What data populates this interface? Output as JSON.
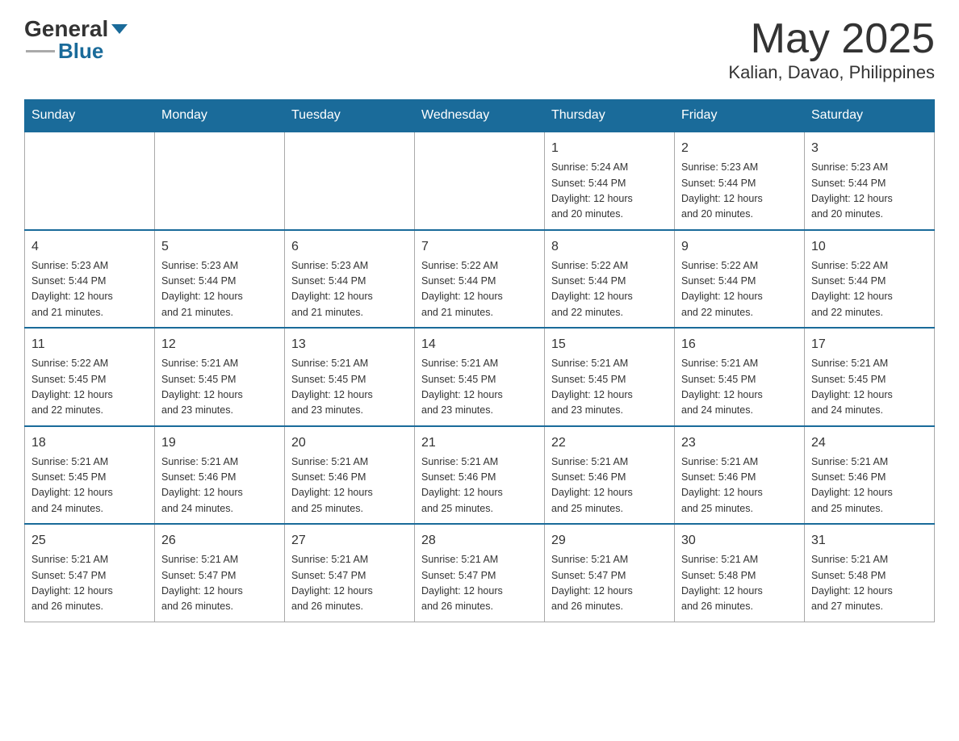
{
  "header": {
    "logo_general": "General",
    "logo_blue": "Blue",
    "month_year": "May 2025",
    "location": "Kalian, Davao, Philippines"
  },
  "days_of_week": [
    "Sunday",
    "Monday",
    "Tuesday",
    "Wednesday",
    "Thursday",
    "Friday",
    "Saturday"
  ],
  "weeks": [
    [
      {
        "day": "",
        "info": ""
      },
      {
        "day": "",
        "info": ""
      },
      {
        "day": "",
        "info": ""
      },
      {
        "day": "",
        "info": ""
      },
      {
        "day": "1",
        "info": "Sunrise: 5:24 AM\nSunset: 5:44 PM\nDaylight: 12 hours\nand 20 minutes."
      },
      {
        "day": "2",
        "info": "Sunrise: 5:23 AM\nSunset: 5:44 PM\nDaylight: 12 hours\nand 20 minutes."
      },
      {
        "day": "3",
        "info": "Sunrise: 5:23 AM\nSunset: 5:44 PM\nDaylight: 12 hours\nand 20 minutes."
      }
    ],
    [
      {
        "day": "4",
        "info": "Sunrise: 5:23 AM\nSunset: 5:44 PM\nDaylight: 12 hours\nand 21 minutes."
      },
      {
        "day": "5",
        "info": "Sunrise: 5:23 AM\nSunset: 5:44 PM\nDaylight: 12 hours\nand 21 minutes."
      },
      {
        "day": "6",
        "info": "Sunrise: 5:23 AM\nSunset: 5:44 PM\nDaylight: 12 hours\nand 21 minutes."
      },
      {
        "day": "7",
        "info": "Sunrise: 5:22 AM\nSunset: 5:44 PM\nDaylight: 12 hours\nand 21 minutes."
      },
      {
        "day": "8",
        "info": "Sunrise: 5:22 AM\nSunset: 5:44 PM\nDaylight: 12 hours\nand 22 minutes."
      },
      {
        "day": "9",
        "info": "Sunrise: 5:22 AM\nSunset: 5:44 PM\nDaylight: 12 hours\nand 22 minutes."
      },
      {
        "day": "10",
        "info": "Sunrise: 5:22 AM\nSunset: 5:44 PM\nDaylight: 12 hours\nand 22 minutes."
      }
    ],
    [
      {
        "day": "11",
        "info": "Sunrise: 5:22 AM\nSunset: 5:45 PM\nDaylight: 12 hours\nand 22 minutes."
      },
      {
        "day": "12",
        "info": "Sunrise: 5:21 AM\nSunset: 5:45 PM\nDaylight: 12 hours\nand 23 minutes."
      },
      {
        "day": "13",
        "info": "Sunrise: 5:21 AM\nSunset: 5:45 PM\nDaylight: 12 hours\nand 23 minutes."
      },
      {
        "day": "14",
        "info": "Sunrise: 5:21 AM\nSunset: 5:45 PM\nDaylight: 12 hours\nand 23 minutes."
      },
      {
        "day": "15",
        "info": "Sunrise: 5:21 AM\nSunset: 5:45 PM\nDaylight: 12 hours\nand 23 minutes."
      },
      {
        "day": "16",
        "info": "Sunrise: 5:21 AM\nSunset: 5:45 PM\nDaylight: 12 hours\nand 24 minutes."
      },
      {
        "day": "17",
        "info": "Sunrise: 5:21 AM\nSunset: 5:45 PM\nDaylight: 12 hours\nand 24 minutes."
      }
    ],
    [
      {
        "day": "18",
        "info": "Sunrise: 5:21 AM\nSunset: 5:45 PM\nDaylight: 12 hours\nand 24 minutes."
      },
      {
        "day": "19",
        "info": "Sunrise: 5:21 AM\nSunset: 5:46 PM\nDaylight: 12 hours\nand 24 minutes."
      },
      {
        "day": "20",
        "info": "Sunrise: 5:21 AM\nSunset: 5:46 PM\nDaylight: 12 hours\nand 25 minutes."
      },
      {
        "day": "21",
        "info": "Sunrise: 5:21 AM\nSunset: 5:46 PM\nDaylight: 12 hours\nand 25 minutes."
      },
      {
        "day": "22",
        "info": "Sunrise: 5:21 AM\nSunset: 5:46 PM\nDaylight: 12 hours\nand 25 minutes."
      },
      {
        "day": "23",
        "info": "Sunrise: 5:21 AM\nSunset: 5:46 PM\nDaylight: 12 hours\nand 25 minutes."
      },
      {
        "day": "24",
        "info": "Sunrise: 5:21 AM\nSunset: 5:46 PM\nDaylight: 12 hours\nand 25 minutes."
      }
    ],
    [
      {
        "day": "25",
        "info": "Sunrise: 5:21 AM\nSunset: 5:47 PM\nDaylight: 12 hours\nand 26 minutes."
      },
      {
        "day": "26",
        "info": "Sunrise: 5:21 AM\nSunset: 5:47 PM\nDaylight: 12 hours\nand 26 minutes."
      },
      {
        "day": "27",
        "info": "Sunrise: 5:21 AM\nSunset: 5:47 PM\nDaylight: 12 hours\nand 26 minutes."
      },
      {
        "day": "28",
        "info": "Sunrise: 5:21 AM\nSunset: 5:47 PM\nDaylight: 12 hours\nand 26 minutes."
      },
      {
        "day": "29",
        "info": "Sunrise: 5:21 AM\nSunset: 5:47 PM\nDaylight: 12 hours\nand 26 minutes."
      },
      {
        "day": "30",
        "info": "Sunrise: 5:21 AM\nSunset: 5:48 PM\nDaylight: 12 hours\nand 26 minutes."
      },
      {
        "day": "31",
        "info": "Sunrise: 5:21 AM\nSunset: 5:48 PM\nDaylight: 12 hours\nand 27 minutes."
      }
    ]
  ]
}
